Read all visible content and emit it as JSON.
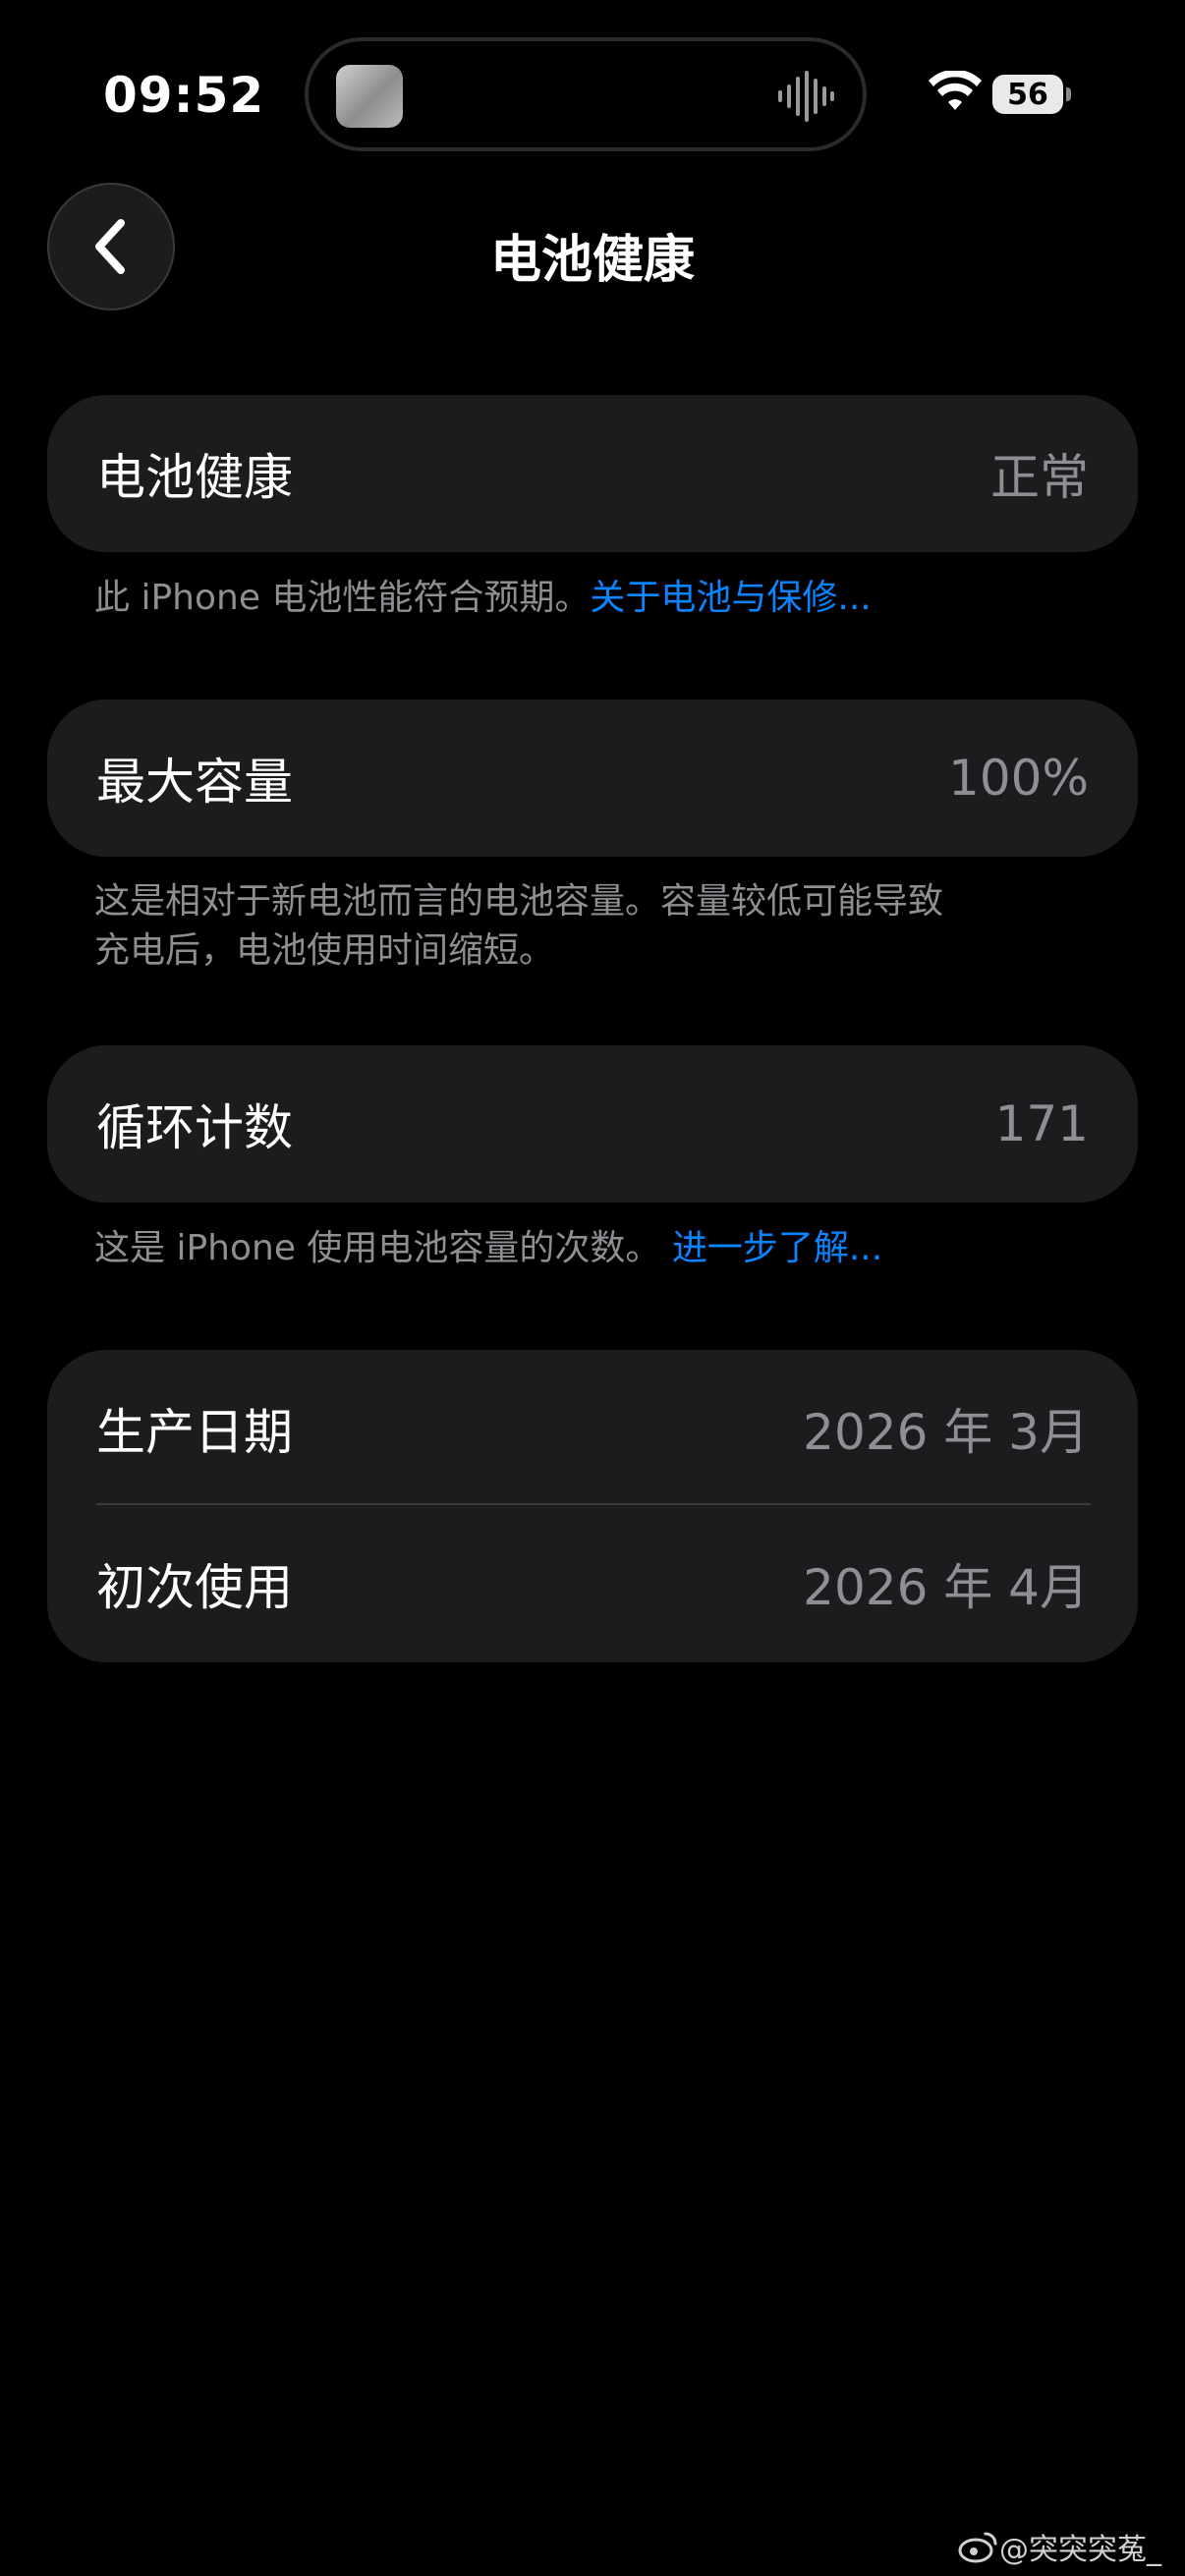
{
  "status_bar": {
    "time": "09:52",
    "battery_level": "56",
    "icons": [
      "now-playing-thumbnail",
      "audio-waveform-icon",
      "wifi-icon",
      "battery-icon"
    ]
  },
  "nav": {
    "back_icon": "chevron-left-icon",
    "title": "电池健康"
  },
  "sections": {
    "health": {
      "label": "电池健康",
      "value": "正常",
      "note": "此 iPhone 电池性能符合预期。",
      "link": "关于电池与保修..."
    },
    "capacity": {
      "label": "最大容量",
      "value": "100%",
      "note_line1": "这是相对于新电池而言的电池容量。容量较低可能导致",
      "note_line2": "充电后，电池使用时间缩短。"
    },
    "cycles": {
      "label": "循环计数",
      "value": "171",
      "note": "这是 iPhone 使用电池容量的次数。",
      "link": "进一步了解..."
    },
    "dates": {
      "manufacture_label": "生产日期",
      "manufacture_value": "2026 年 3月",
      "first_use_label": "初次使用",
      "first_use_value": "2026 年 4月"
    }
  },
  "watermark": "@突突突菟_",
  "colors": {
    "background": "#000000",
    "card": "#1c1c1e",
    "secondary_text": "#8e8e93",
    "link": "#0a84ff"
  }
}
